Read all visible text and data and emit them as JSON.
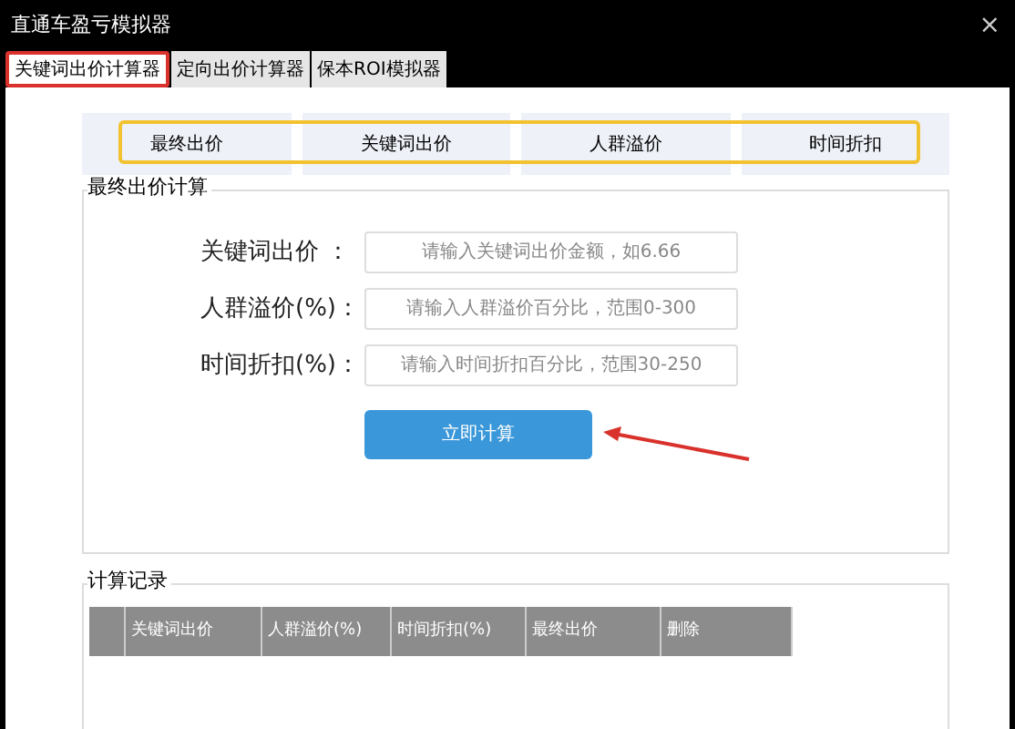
{
  "window": {
    "title": "直通车盈亏模拟器",
    "close": "×"
  },
  "tabs": [
    {
      "label": "关键词出价计算器",
      "selected": true,
      "annotated": true
    },
    {
      "label": "定向出价计算器",
      "selected": false,
      "annotated": false
    },
    {
      "label": "保本ROI模拟器",
      "selected": false,
      "annotated": false
    }
  ],
  "header_strip": {
    "items": [
      "最终出价",
      "关键词出价",
      "人群溢价",
      "时间折扣"
    ],
    "annotated": true
  },
  "calculator": {
    "title": "最终出价计算",
    "fields": [
      {
        "label": "关键词出价 ：",
        "placeholder": "请输入关键词出价金额，如6.66"
      },
      {
        "label": "人群溢价(%)：",
        "placeholder": "请输入人群溢价百分比，范围0-300"
      },
      {
        "label": "时间折扣(%)：",
        "placeholder": "请输入时间折扣百分比，范围30-250"
      }
    ],
    "button": "立即计算",
    "arrow": true
  },
  "history": {
    "title": "计算记录",
    "columns": [
      "",
      "关键词出价",
      "人群溢价(%)",
      "时间折扣(%)",
      "最终出价",
      "删除"
    ]
  }
}
